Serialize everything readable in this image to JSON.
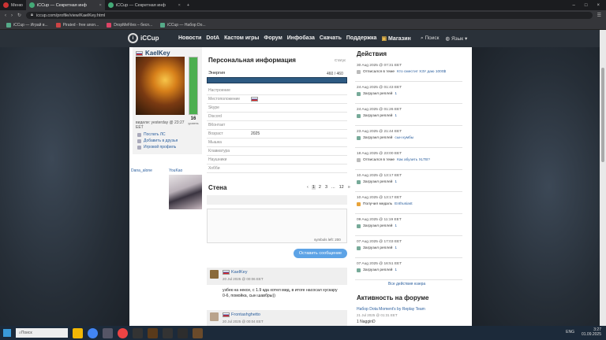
{
  "browser": {
    "menu_label": "Меню",
    "tabs": [
      {
        "title": "iCCup — Секретная инф",
        "active": true
      },
      {
        "title": "iCCup — Секретная инф",
        "active": false
      }
    ],
    "url": "iccup.com/profile/view/KaelKey.html",
    "bookmarks": [
      "iCCup — Играй в...",
      "Pirated - free anon...",
      "DropMeFiles – бесп...",
      "iCCup — Набор Do..."
    ]
  },
  "site": {
    "logo": "iCCup",
    "nav": [
      "Новости",
      "DotA",
      "Кастом игры",
      "Форум",
      "Инфобаза",
      "Скачать",
      "Поддержка",
      "Магазин"
    ],
    "search_label": "Поиск",
    "lang_label": "Язык"
  },
  "profile": {
    "username": "KaelKey",
    "level": "16",
    "level_sub": "уровень",
    "energy_fraction": 1.0,
    "last_seen": "видели: yesterday @ 23:27 EET",
    "actions": [
      "Послать ЛС",
      "Добавить в друзья",
      "Игровой профиль"
    ],
    "friends": [
      "Dana_alone",
      "YouKao"
    ]
  },
  "info": {
    "title": "Персональная информация",
    "status_label": "Статус",
    "energy_label": "Энергия",
    "energy_value": "460 / 460",
    "rows": [
      {
        "k": "Настроение",
        "v": ""
      },
      {
        "k": "Местоположение",
        "v": ""
      },
      {
        "k": "Skype",
        "v": ""
      },
      {
        "k": "Discord",
        "v": ""
      },
      {
        "k": "ВКонтакт",
        "v": ""
      },
      {
        "k": "Возраст",
        "v": "2025"
      },
      {
        "k": "Мышка",
        "v": ""
      },
      {
        "k": "Клавиатура",
        "v": ""
      },
      {
        "k": "Наушники",
        "v": ""
      },
      {
        "k": "Хобби",
        "v": ""
      }
    ]
  },
  "wall": {
    "title": "Стена",
    "pages": [
      "1",
      "2",
      "3",
      "...",
      "12",
      "»"
    ],
    "current_page": "1",
    "symbols_left": "symbols left: 200",
    "send_label": "Оставить сообщение",
    "posts": [
      {
        "author": "KaelKey",
        "date": "20 Jul 2025 @ 00:06 EET",
        "text": "узбек на нексе, с 1.9 кда хотел мид, в итоге насосал хускару 0-6, помойка, сын шавбры))"
      },
      {
        "author": "Frontashghetto",
        "date": "20 Jul 2025 @ 00:04 EET",
        "text": ""
      }
    ]
  },
  "activity": {
    "title": "Действия",
    "events": [
      {
        "date": "30 Aug 2025 @ 07:31 EET",
        "action": "Отписался в теме",
        "link": "Кто сместит X3У даю 1000$"
      },
      {
        "date": "24 Aug 2025 @ 01:43 EET",
        "action": "Загрузил реплей",
        "link": "1"
      },
      {
        "date": "24 Aug 2025 @ 01:26 EET",
        "action": "Загрузил реплей",
        "link": "1"
      },
      {
        "date": "23 Aug 2025 @ 21:44 EET",
        "action": "Загрузил реплей",
        "link": "сын кумбы"
      },
      {
        "date": "18 Aug 2025 @ 23:00 EET",
        "action": "Отписался в теме",
        "link": "Как абузить XLTB?"
      },
      {
        "date": "10 Aug 2025 @ 13:17 EET",
        "action": "Загрузил реплей",
        "link": "1"
      },
      {
        "date": "10 Aug 2025 @ 13:17 EET",
        "action": "Получил медаль",
        "link": "Enthusiast"
      },
      {
        "date": "09 Aug 2025 @ 11:19 EET",
        "action": "Загрузил реплей",
        "link": "1"
      },
      {
        "date": "07 Aug 2025 @ 17:03 EET",
        "action": "Загрузил реплей",
        "link": "1"
      },
      {
        "date": "07 Aug 2025 @ 16:51 EET",
        "action": "Загрузил реплей",
        "link": "1"
      }
    ],
    "all_link": "Все действия юзера"
  },
  "forum": {
    "title": "Активность на форуме",
    "thread": "Набор Dota Moment's by Replay Team",
    "date": "21 Jul 2025 @ 01:31 EET",
    "user": "1 NagginD"
  },
  "taskbar": {
    "search_placeholder": "Поиск",
    "lang": "ENG",
    "time": "3:27",
    "date": "01.09.2025"
  },
  "colors": {
    "accent": "#5da3e6",
    "nav_bg": "#2a3139",
    "energy": "#2d5a82"
  }
}
